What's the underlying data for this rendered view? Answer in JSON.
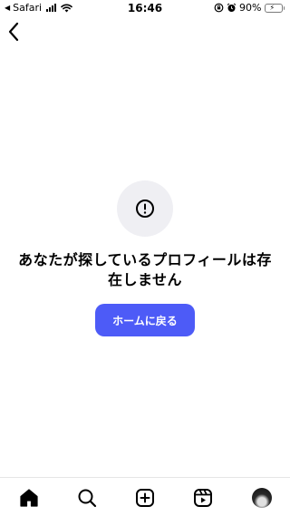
{
  "status_bar": {
    "back_app": "Safari",
    "time": "16:46",
    "battery_percent": "90%",
    "battery_level": 0.9
  },
  "header": {
    "back_icon": "chevron-left-icon"
  },
  "error": {
    "icon": "exclamation-circle-icon",
    "message": "あなたが探しているプロフィールは存在しません",
    "button_label": "ホームに戻る"
  },
  "bottom_nav": {
    "items": [
      {
        "name": "home",
        "icon": "home-icon"
      },
      {
        "name": "search",
        "icon": "search-icon"
      },
      {
        "name": "create",
        "icon": "plus-square-icon"
      },
      {
        "name": "reels",
        "icon": "reels-icon"
      },
      {
        "name": "profile",
        "icon": "avatar"
      }
    ]
  },
  "colors": {
    "button_bg": "#4d5bf7",
    "icon_circle_bg": "#efeff3",
    "battery_fill": "#4cd964"
  }
}
